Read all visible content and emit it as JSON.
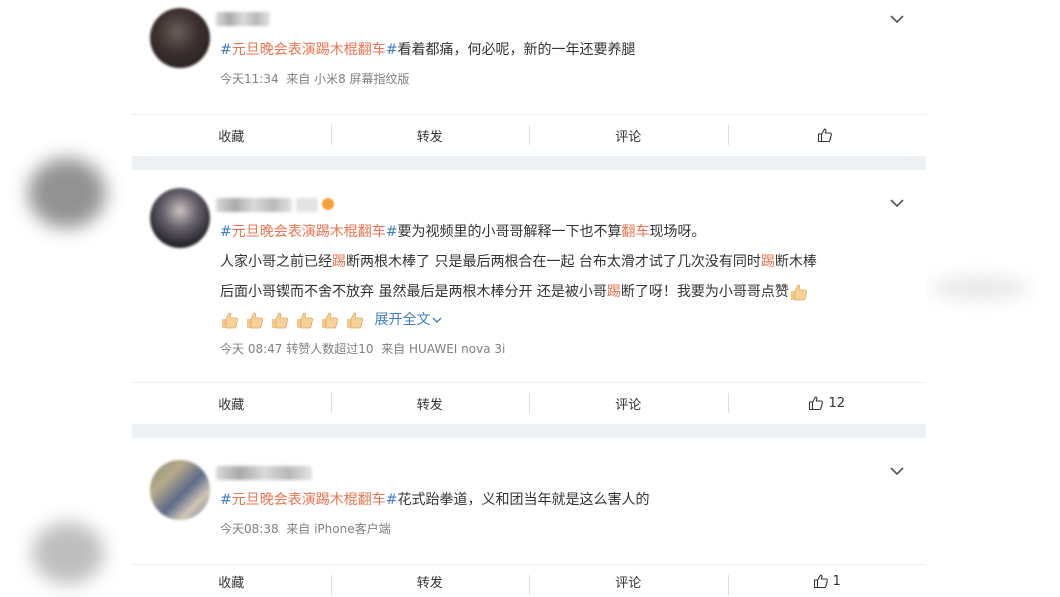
{
  "actions": {
    "collect": "收藏",
    "repost": "转发",
    "comment": "评论"
  },
  "posts": [
    {
      "topic_hash_l": "#",
      "topic": "元旦晚会表演踢木棍翻车",
      "topic_hash_r": "#",
      "body": "看着都痛，何必呢，新的一年还要养腿",
      "time": "今天11:34",
      "source_prefix": "来自",
      "source": "小米8 屏幕指纹版",
      "likes": ""
    },
    {
      "topic_hash_l": "#",
      "topic": "元旦晚会表演踢木棍翻车",
      "topic_hash_r": "#",
      "body_a": "要为视频里的小哥哥解释一下也不算",
      "body_hl": "翻车",
      "body_b": "现场呀。",
      "line2_a": "人家小哥之前已经",
      "line2_hl": "踢",
      "line2_b": "断两根木棒了 只是最后两根合在一起 台布太滑才试了几次没有同时",
      "line2_hl2": "踢",
      "line2_c": "断木棒",
      "line3_a": "后面小哥锲而不舍不放弃 虽然最后是两根木棒分开 还是被小哥",
      "line3_hl": "踢",
      "line3_b": "断了呀！我要为小哥哥点赞",
      "expand": "展开全文",
      "time": "今天 08:47",
      "views": "转赞人数超过10",
      "source_prefix": "来自",
      "source": "HUAWEI nova 3i",
      "likes": "12"
    },
    {
      "topic_hash_l": "#",
      "topic": "元旦晚会表演踢木棍翻车",
      "topic_hash_r": "#",
      "body": "花式跆拳道，义和团当年就是这么害人的",
      "time": "今天08:38",
      "source_prefix": "来自",
      "source": "iPhone客户端",
      "likes": "1"
    }
  ],
  "colors": {
    "topic": "#eb7350",
    "hash": "#3f7ec2",
    "link": "#3f7ec2",
    "meta": "#808080",
    "feed_bg": "#eef1f4"
  },
  "icons": [
    "chevron-down-icon",
    "like-icon",
    "thumbs-up-emoji"
  ]
}
